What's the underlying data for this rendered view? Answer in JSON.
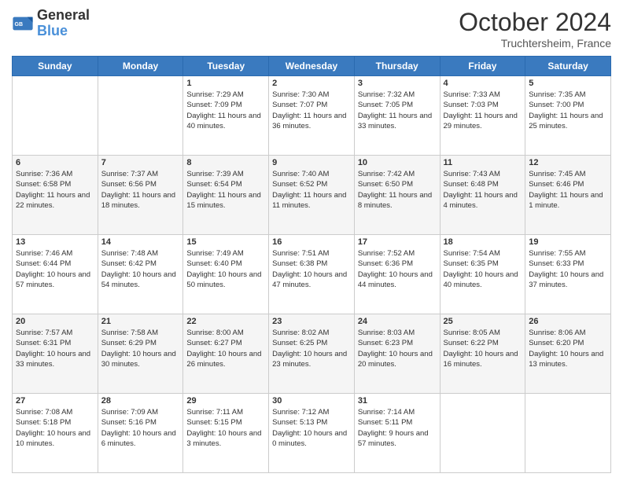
{
  "header": {
    "logo_text_general": "General",
    "logo_text_blue": "Blue",
    "month": "October 2024",
    "location": "Truchtersheim, France"
  },
  "weekdays": [
    "Sunday",
    "Monday",
    "Tuesday",
    "Wednesday",
    "Thursday",
    "Friday",
    "Saturday"
  ],
  "weeks": [
    [
      {
        "day": "",
        "sunrise": "",
        "sunset": "",
        "daylight": ""
      },
      {
        "day": "",
        "sunrise": "",
        "sunset": "",
        "daylight": ""
      },
      {
        "day": "1",
        "sunrise": "Sunrise: 7:29 AM",
        "sunset": "Sunset: 7:09 PM",
        "daylight": "Daylight: 11 hours and 40 minutes."
      },
      {
        "day": "2",
        "sunrise": "Sunrise: 7:30 AM",
        "sunset": "Sunset: 7:07 PM",
        "daylight": "Daylight: 11 hours and 36 minutes."
      },
      {
        "day": "3",
        "sunrise": "Sunrise: 7:32 AM",
        "sunset": "Sunset: 7:05 PM",
        "daylight": "Daylight: 11 hours and 33 minutes."
      },
      {
        "day": "4",
        "sunrise": "Sunrise: 7:33 AM",
        "sunset": "Sunset: 7:03 PM",
        "daylight": "Daylight: 11 hours and 29 minutes."
      },
      {
        "day": "5",
        "sunrise": "Sunrise: 7:35 AM",
        "sunset": "Sunset: 7:00 PM",
        "daylight": "Daylight: 11 hours and 25 minutes."
      }
    ],
    [
      {
        "day": "6",
        "sunrise": "Sunrise: 7:36 AM",
        "sunset": "Sunset: 6:58 PM",
        "daylight": "Daylight: 11 hours and 22 minutes."
      },
      {
        "day": "7",
        "sunrise": "Sunrise: 7:37 AM",
        "sunset": "Sunset: 6:56 PM",
        "daylight": "Daylight: 11 hours and 18 minutes."
      },
      {
        "day": "8",
        "sunrise": "Sunrise: 7:39 AM",
        "sunset": "Sunset: 6:54 PM",
        "daylight": "Daylight: 11 hours and 15 minutes."
      },
      {
        "day": "9",
        "sunrise": "Sunrise: 7:40 AM",
        "sunset": "Sunset: 6:52 PM",
        "daylight": "Daylight: 11 hours and 11 minutes."
      },
      {
        "day": "10",
        "sunrise": "Sunrise: 7:42 AM",
        "sunset": "Sunset: 6:50 PM",
        "daylight": "Daylight: 11 hours and 8 minutes."
      },
      {
        "day": "11",
        "sunrise": "Sunrise: 7:43 AM",
        "sunset": "Sunset: 6:48 PM",
        "daylight": "Daylight: 11 hours and 4 minutes."
      },
      {
        "day": "12",
        "sunrise": "Sunrise: 7:45 AM",
        "sunset": "Sunset: 6:46 PM",
        "daylight": "Daylight: 11 hours and 1 minute."
      }
    ],
    [
      {
        "day": "13",
        "sunrise": "Sunrise: 7:46 AM",
        "sunset": "Sunset: 6:44 PM",
        "daylight": "Daylight: 10 hours and 57 minutes."
      },
      {
        "day": "14",
        "sunrise": "Sunrise: 7:48 AM",
        "sunset": "Sunset: 6:42 PM",
        "daylight": "Daylight: 10 hours and 54 minutes."
      },
      {
        "day": "15",
        "sunrise": "Sunrise: 7:49 AM",
        "sunset": "Sunset: 6:40 PM",
        "daylight": "Daylight: 10 hours and 50 minutes."
      },
      {
        "day": "16",
        "sunrise": "Sunrise: 7:51 AM",
        "sunset": "Sunset: 6:38 PM",
        "daylight": "Daylight: 10 hours and 47 minutes."
      },
      {
        "day": "17",
        "sunrise": "Sunrise: 7:52 AM",
        "sunset": "Sunset: 6:36 PM",
        "daylight": "Daylight: 10 hours and 44 minutes."
      },
      {
        "day": "18",
        "sunrise": "Sunrise: 7:54 AM",
        "sunset": "Sunset: 6:35 PM",
        "daylight": "Daylight: 10 hours and 40 minutes."
      },
      {
        "day": "19",
        "sunrise": "Sunrise: 7:55 AM",
        "sunset": "Sunset: 6:33 PM",
        "daylight": "Daylight: 10 hours and 37 minutes."
      }
    ],
    [
      {
        "day": "20",
        "sunrise": "Sunrise: 7:57 AM",
        "sunset": "Sunset: 6:31 PM",
        "daylight": "Daylight: 10 hours and 33 minutes."
      },
      {
        "day": "21",
        "sunrise": "Sunrise: 7:58 AM",
        "sunset": "Sunset: 6:29 PM",
        "daylight": "Daylight: 10 hours and 30 minutes."
      },
      {
        "day": "22",
        "sunrise": "Sunrise: 8:00 AM",
        "sunset": "Sunset: 6:27 PM",
        "daylight": "Daylight: 10 hours and 26 minutes."
      },
      {
        "day": "23",
        "sunrise": "Sunrise: 8:02 AM",
        "sunset": "Sunset: 6:25 PM",
        "daylight": "Daylight: 10 hours and 23 minutes."
      },
      {
        "day": "24",
        "sunrise": "Sunrise: 8:03 AM",
        "sunset": "Sunset: 6:23 PM",
        "daylight": "Daylight: 10 hours and 20 minutes."
      },
      {
        "day": "25",
        "sunrise": "Sunrise: 8:05 AM",
        "sunset": "Sunset: 6:22 PM",
        "daylight": "Daylight: 10 hours and 16 minutes."
      },
      {
        "day": "26",
        "sunrise": "Sunrise: 8:06 AM",
        "sunset": "Sunset: 6:20 PM",
        "daylight": "Daylight: 10 hours and 13 minutes."
      }
    ],
    [
      {
        "day": "27",
        "sunrise": "Sunrise: 7:08 AM",
        "sunset": "Sunset: 5:18 PM",
        "daylight": "Daylight: 10 hours and 10 minutes."
      },
      {
        "day": "28",
        "sunrise": "Sunrise: 7:09 AM",
        "sunset": "Sunset: 5:16 PM",
        "daylight": "Daylight: 10 hours and 6 minutes."
      },
      {
        "day": "29",
        "sunrise": "Sunrise: 7:11 AM",
        "sunset": "Sunset: 5:15 PM",
        "daylight": "Daylight: 10 hours and 3 minutes."
      },
      {
        "day": "30",
        "sunrise": "Sunrise: 7:12 AM",
        "sunset": "Sunset: 5:13 PM",
        "daylight": "Daylight: 10 hours and 0 minutes."
      },
      {
        "day": "31",
        "sunrise": "Sunrise: 7:14 AM",
        "sunset": "Sunset: 5:11 PM",
        "daylight": "Daylight: 9 hours and 57 minutes."
      },
      {
        "day": "",
        "sunrise": "",
        "sunset": "",
        "daylight": ""
      },
      {
        "day": "",
        "sunrise": "",
        "sunset": "",
        "daylight": ""
      }
    ]
  ]
}
